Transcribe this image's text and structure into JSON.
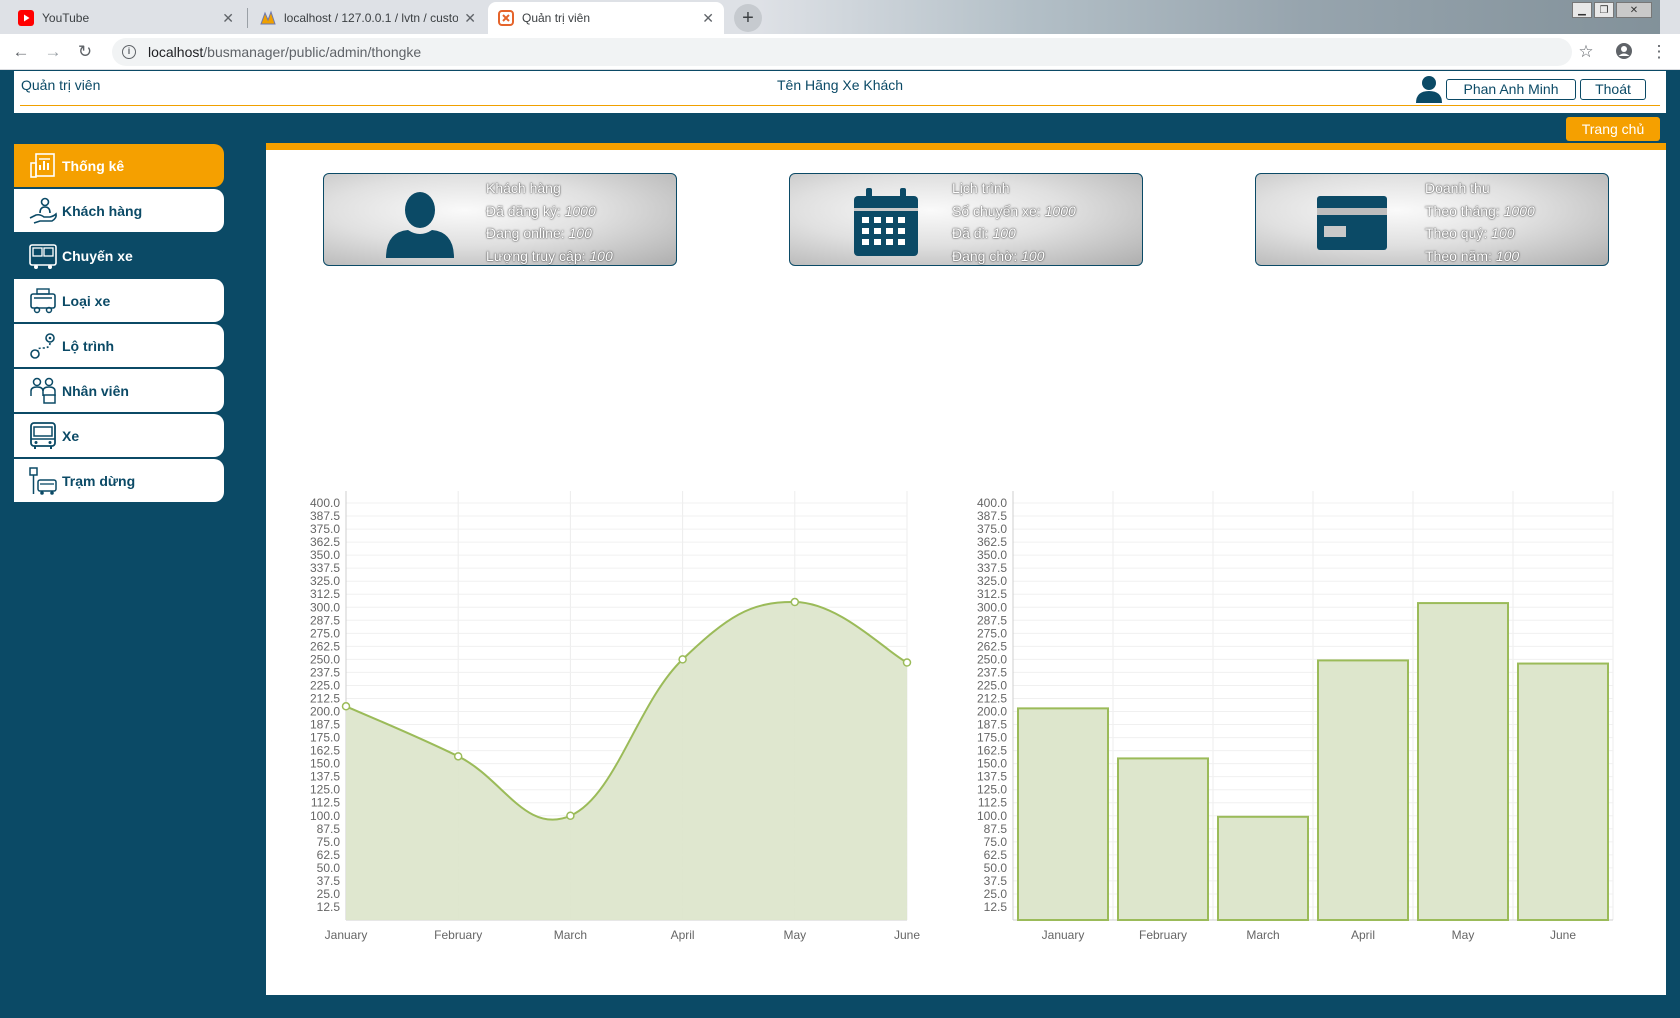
{
  "browser": {
    "tabs": [
      {
        "title": "YouTube",
        "icon": "youtube-icon"
      },
      {
        "title": "localhost / 127.0.0.1 / lvtn / custo",
        "icon": "phpmyadmin-icon"
      },
      {
        "title": "Quản trị viên",
        "icon": "xampp-icon"
      }
    ],
    "url_host": "localhost",
    "url_path": "/busmanager/public/admin/thongke"
  },
  "header": {
    "left_title": "Quản trị viên",
    "center_title": "Tên Hãng Xe Khách",
    "user_name": "Phan Anh Minh",
    "logout_label": "Thoát",
    "home_label": "Trang chủ"
  },
  "sidebar": {
    "items": [
      {
        "label": "Thống kê",
        "icon": "statistics-icon",
        "state": "active"
      },
      {
        "label": "Khách hàng",
        "icon": "customer-hand-icon",
        "state": "normal"
      },
      {
        "label": "Chuyến xe",
        "icon": "bus-trip-icon",
        "state": "plain"
      },
      {
        "label": "Loại xe",
        "icon": "vehicle-type-icon",
        "state": "normal"
      },
      {
        "label": "Lộ trình",
        "icon": "route-icon",
        "state": "normal"
      },
      {
        "label": "Nhân viên",
        "icon": "employees-icon",
        "state": "normal"
      },
      {
        "label": "Xe",
        "icon": "bus-icon",
        "state": "normal"
      },
      {
        "label": "Trạm dừng",
        "icon": "bus-stop-icon",
        "state": "normal"
      }
    ]
  },
  "cards": [
    {
      "title": "Khách hàng",
      "icon": "user-silhouette-icon",
      "rows": [
        {
          "label": "Đã đăng ký:",
          "value": "1000"
        },
        {
          "label": "Đang online:",
          "value": "100"
        },
        {
          "label": "Lượng truy cập:",
          "value": "100"
        }
      ]
    },
    {
      "title": "Lịch trình",
      "icon": "calendar-icon",
      "rows": [
        {
          "label": "Số chuyến xe:",
          "value": "1000"
        },
        {
          "label": "Đã đi:",
          "value": "100"
        },
        {
          "label": "Đang chờ:",
          "value": "100"
        }
      ]
    },
    {
      "title": "Doanh thu",
      "icon": "credit-card-icon",
      "rows": [
        {
          "label": "Theo tháng:",
          "value": "1000"
        },
        {
          "label": "Theo quý:",
          "value": "100"
        },
        {
          "label": "Theo năm:",
          "value": "100"
        }
      ]
    }
  ],
  "colors": {
    "primary": "#0b4a66",
    "accent": "#f5a000",
    "series_stroke": "#9bbb59",
    "series_fill": "#dde6cc"
  },
  "chart_data": [
    {
      "type": "area",
      "categories": [
        "January",
        "February",
        "March",
        "April",
        "May",
        "June"
      ],
      "series": [
        {
          "values": [
            205,
            157,
            100,
            250,
            305,
            247
          ]
        }
      ],
      "ylim": [
        0,
        400
      ],
      "yticks": [
        "12.5",
        "25.0",
        "37.5",
        "50.0",
        "62.5",
        "75.0",
        "87.5",
        "100.0",
        "112.5",
        "125.0",
        "137.5",
        "150.0",
        "162.5",
        "175.0",
        "187.5",
        "200.0",
        "212.5",
        "225.0",
        "237.5",
        "250.0",
        "262.5",
        "275.0",
        "287.5",
        "300.0",
        "312.5",
        "325.0",
        "337.5",
        "350.0",
        "362.5",
        "375.0",
        "387.5",
        "400.0"
      ],
      "grid": true,
      "title": "",
      "xlabel": "",
      "ylabel": ""
    },
    {
      "type": "bar",
      "categories": [
        "January",
        "February",
        "March",
        "April",
        "May",
        "June"
      ],
      "series": [
        {
          "values": [
            203,
            155,
            99,
            249,
            304,
            246
          ]
        }
      ],
      "ylim": [
        0,
        400
      ],
      "yticks": [
        "12.5",
        "25.0",
        "37.5",
        "50.0",
        "62.5",
        "75.0",
        "87.5",
        "100.0",
        "112.5",
        "125.0",
        "137.5",
        "150.0",
        "162.5",
        "175.0",
        "187.5",
        "200.0",
        "212.5",
        "225.0",
        "237.5",
        "250.0",
        "262.5",
        "275.0",
        "287.5",
        "300.0",
        "312.5",
        "325.0",
        "337.5",
        "350.0",
        "362.5",
        "375.0",
        "387.5",
        "400.0"
      ],
      "grid": true,
      "title": "",
      "xlabel": "",
      "ylabel": ""
    }
  ]
}
